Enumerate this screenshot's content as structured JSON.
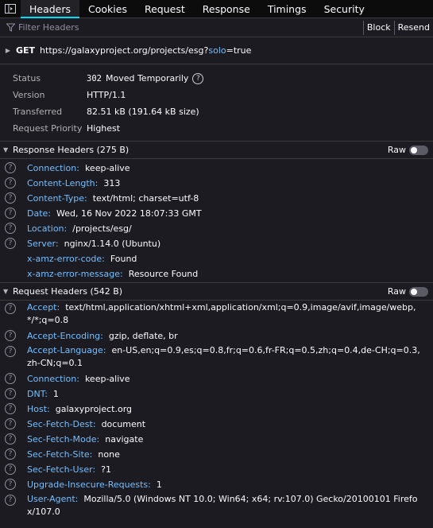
{
  "tabs": [
    {
      "label": "Headers",
      "active": true
    },
    {
      "label": "Cookies",
      "active": false
    },
    {
      "label": "Request",
      "active": false
    },
    {
      "label": "Response",
      "active": false
    },
    {
      "label": "Timings",
      "active": false
    },
    {
      "label": "Security",
      "active": false
    }
  ],
  "filter": {
    "placeholder": "Filter Headers",
    "block_label": "Block",
    "resend_label": "Resend"
  },
  "request": {
    "method": "GET",
    "url_base": "https://galaxyproject.org/projects/esg?",
    "param_key": "solo",
    "param_eq": "=",
    "param_val": "true"
  },
  "summary": {
    "status_label": "Status",
    "status_code": "302",
    "status_text": "Moved Temporarily",
    "version_label": "Version",
    "version_value": "HTTP/1.1",
    "transferred_label": "Transferred",
    "transferred_value": "82.51 kB (191.64 kB size)",
    "priority_label": "Request Priority",
    "priority_value": "Highest"
  },
  "response_headers": {
    "title": "Response Headers (275 B)",
    "raw_label": "Raw",
    "items": [
      {
        "name": "Connection:",
        "value": "keep-alive",
        "help": true
      },
      {
        "name": "Content-Length:",
        "value": "313",
        "help": true
      },
      {
        "name": "Content-Type:",
        "value": "text/html; charset=utf-8",
        "help": true
      },
      {
        "name": "Date:",
        "value": "Wed, 16 Nov 2022 18:07:33 GMT",
        "help": true
      },
      {
        "name": "Location:",
        "value": "/projects/esg/",
        "help": true
      },
      {
        "name": "Server:",
        "value": "nginx/1.14.0 (Ubuntu)",
        "help": true
      },
      {
        "name": "x-amz-error-code:",
        "value": "Found",
        "help": false
      },
      {
        "name": "x-amz-error-message:",
        "value": "Resource Found",
        "help": false
      }
    ]
  },
  "request_headers": {
    "title": "Request Headers (542 B)",
    "raw_label": "Raw",
    "items": [
      {
        "name": "Accept:",
        "value": "text/html,application/xhtml+xml,application/xml;q=0.9,image/avif,image/webp,*/*;q=0.8",
        "help": true
      },
      {
        "name": "Accept-Encoding:",
        "value": "gzip, deflate, br",
        "help": true
      },
      {
        "name": "Accept-Language:",
        "value": "en-US,en;q=0.9,es;q=0.8,fr;q=0.6,fr-FR;q=0.5,zh;q=0.4,de-CH;q=0.3,zh-CN;q=0.1",
        "help": true
      },
      {
        "name": "Connection:",
        "value": "keep-alive",
        "help": true
      },
      {
        "name": "DNT:",
        "value": "1",
        "help": true
      },
      {
        "name": "Host:",
        "value": "galaxyproject.org",
        "help": true
      },
      {
        "name": "Sec-Fetch-Dest:",
        "value": "document",
        "help": true
      },
      {
        "name": "Sec-Fetch-Mode:",
        "value": "navigate",
        "help": true
      },
      {
        "name": "Sec-Fetch-Site:",
        "value": "none",
        "help": true
      },
      {
        "name": "Sec-Fetch-User:",
        "value": "?1",
        "help": true
      },
      {
        "name": "Upgrade-Insecure-Requests:",
        "value": "1",
        "help": true
      },
      {
        "name": "User-Agent:",
        "value": "Mozilla/5.0 (Windows NT 10.0; Win64; x64; rv:107.0) Gecko/20100101 Firefox/107.0",
        "help": true
      }
    ]
  },
  "icons": {
    "dock": "dock-side-icon",
    "filter": "filter-icon",
    "help": "help-icon",
    "help_glyph": "?",
    "expand": "expand-triangle-icon"
  },
  "colors": {
    "background": "#1c1b22",
    "tab_accent": "#00ddff",
    "header_name": "#75bfff",
    "text": "#fbfbfe",
    "muted": "#b1b1b3"
  }
}
